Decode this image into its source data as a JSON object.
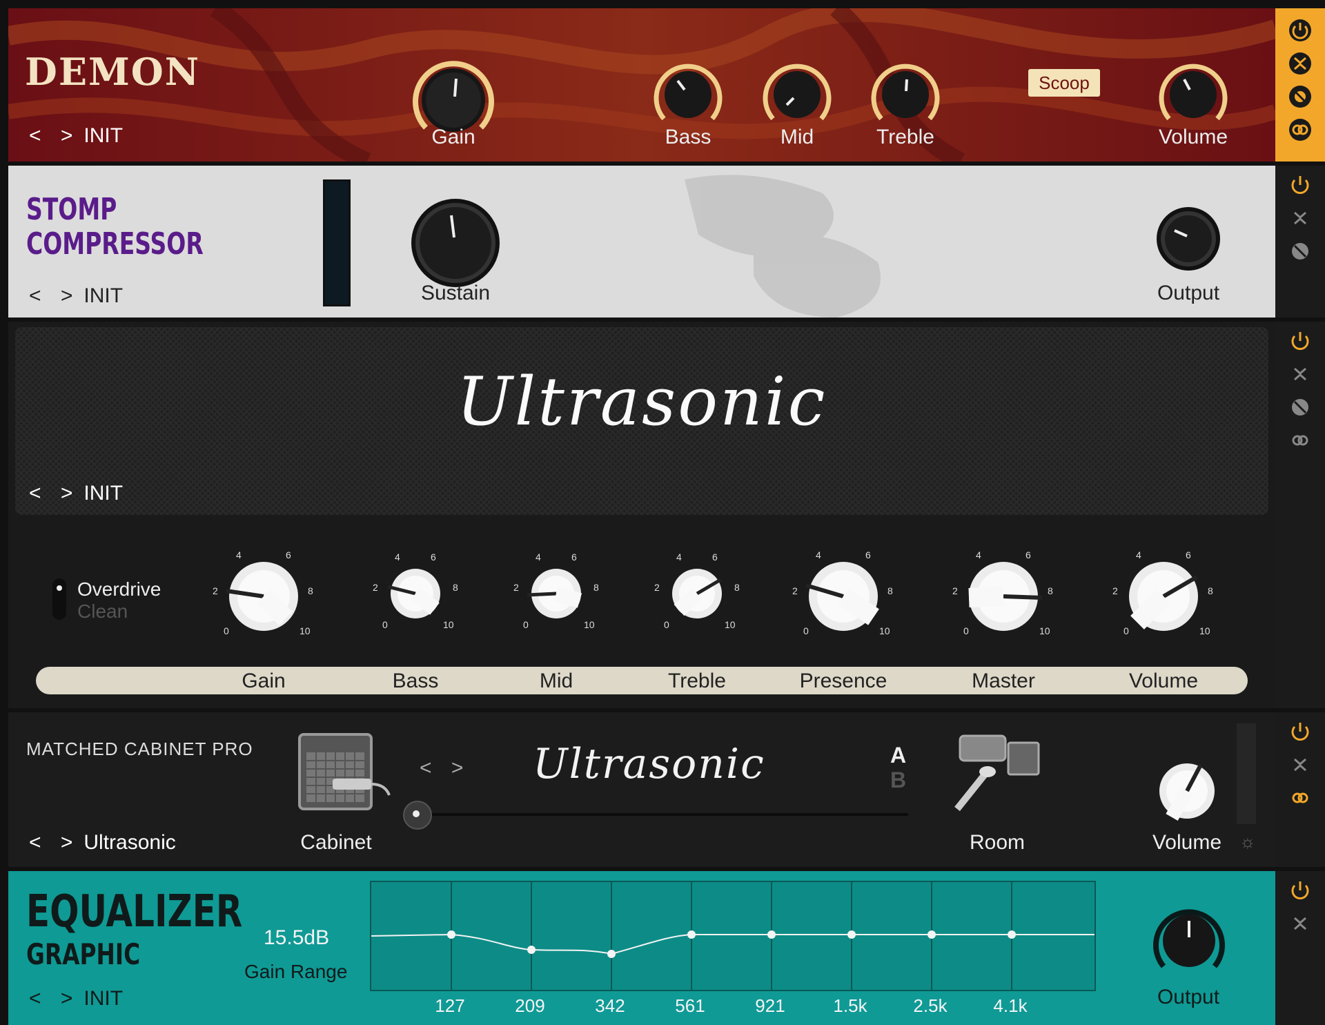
{
  "colors": {
    "accent": "#f2a72b",
    "demon_bg": "#6e1414",
    "eq_bg": "#0f9a95",
    "compressor_title": "#5a1c8a"
  },
  "demon": {
    "logo": "DEMON",
    "preset": "INIT",
    "nav": "< >",
    "knobs": {
      "gain": "Gain",
      "bass": "Bass",
      "mid": "Mid",
      "treble": "Treble",
      "volume": "Volume"
    },
    "scoop": "Scoop"
  },
  "compressor": {
    "title_line1": "STOMP",
    "title_line2": "COMPRESSOR",
    "preset": "INIT",
    "nav": "< >",
    "sustain": "Sustain",
    "output": "Output"
  },
  "ultrasonic": {
    "logo": "Ultrasonic",
    "preset": "INIT",
    "nav": "< >",
    "mode_options": [
      "Overdrive",
      "Clean"
    ],
    "mode_selected": "Overdrive",
    "knobs": [
      "Gain",
      "Bass",
      "Mid",
      "Treble",
      "Presence",
      "Master",
      "Volume"
    ],
    "scale": {
      "s0": "0",
      "s2": "2",
      "s4": "4",
      "s6": "6",
      "s8": "8",
      "s10": "10"
    }
  },
  "cabinet": {
    "title": "MATCHED CABINET PRO",
    "preset": "Ultrasonic",
    "nav": "< >",
    "cabinet_label": "Cabinet",
    "cab_nav": "< >",
    "logo": "Ultrasonic",
    "ab_a": "A",
    "ab_b": "B",
    "room_label": "Room",
    "volume_label": "Volume"
  },
  "equalizer": {
    "title_line1": "EQUALIZER",
    "title_line2": "GRAPHIC",
    "preset": "INIT",
    "nav": "< >",
    "gain_value": "15.5dB",
    "gain_label": "Gain Range",
    "bands": [
      "127",
      "209",
      "342",
      "561",
      "921",
      "1.5k",
      "2.5k",
      "4.1k"
    ],
    "output": "Output"
  },
  "sidebar": {
    "icons": [
      "power-icon",
      "collapse-icon",
      "settings-icon",
      "link-icon"
    ]
  }
}
